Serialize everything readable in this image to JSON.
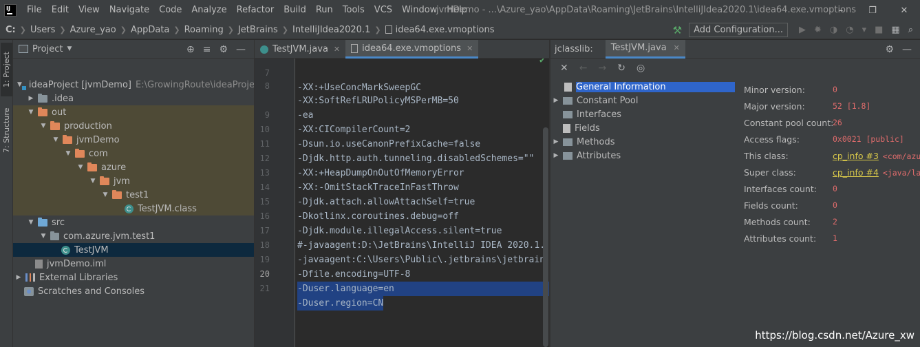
{
  "titlebar": {
    "menu": [
      "File",
      "Edit",
      "View",
      "Navigate",
      "Code",
      "Analyze",
      "Refactor",
      "Build",
      "Run",
      "Tools",
      "VCS",
      "Window",
      "Help"
    ],
    "window_title": "jvmDemo - ...\\Azure_yao\\AppData\\Roaming\\JetBrains\\IntelliJIdea2020.1\\idea64.exe.vmoptions"
  },
  "navbar": {
    "breadcrumbs": [
      "C:",
      "Users",
      "Azure_yao",
      "AppData",
      "Roaming",
      "JetBrains",
      "IntelliJIdea2020.1",
      "idea64.exe.vmoptions"
    ],
    "config_button": "Add Configuration..."
  },
  "left_strip": {
    "tabs": [
      "1: Project",
      "7: Structure"
    ]
  },
  "project_panel": {
    "title": "Project",
    "tree": [
      {
        "label": "ideaProject",
        "bold": "[jvmDemo]",
        "hint": "E:\\GrowingRoute\\ideaProject"
      },
      {
        "label": ".idea"
      },
      {
        "label": "out"
      },
      {
        "label": "production"
      },
      {
        "label": "jvmDemo"
      },
      {
        "label": "com"
      },
      {
        "label": "azure"
      },
      {
        "label": "jvm"
      },
      {
        "label": "test1"
      },
      {
        "label": "TestJVM.class"
      },
      {
        "label": "src"
      },
      {
        "label": "com.azure.jvm.test1"
      },
      {
        "label": "TestJVM"
      },
      {
        "label": "jvmDemo.iml"
      },
      {
        "label": "External Libraries"
      },
      {
        "label": "Scratches and Consoles"
      }
    ]
  },
  "editor": {
    "tabs": [
      {
        "label": "TestJVM.java"
      },
      {
        "label": "idea64.exe.vmoptions"
      }
    ],
    "lines": [
      {
        "n": "7",
        "text": "-XX:+UseConcMarkSweepGC"
      },
      {
        "n": "8",
        "text": "-XX:SoftRefLRUPolicyMSPerMB=50"
      },
      {
        "n": "",
        "text": "-ea"
      },
      {
        "n": "9",
        "text": "-XX:CICompilerCount=2"
      },
      {
        "n": "10",
        "text": "-Dsun.io.useCanonPrefixCache=false"
      },
      {
        "n": "11",
        "text": "-Djdk.http.auth.tunneling.disabledSchemes=\"\""
      },
      {
        "n": "12",
        "text": "-XX:+HeapDumpOnOutOfMemoryError"
      },
      {
        "n": "13",
        "text": "-XX:-OmitStackTraceInFastThrow"
      },
      {
        "n": "14",
        "text": "-Djdk.attach.allowAttachSelf=true"
      },
      {
        "n": "15",
        "text": "-Dkotlinx.coroutines.debug=off"
      },
      {
        "n": "16",
        "text": "-Djdk.module.illegalAccess.silent=true"
      },
      {
        "n": "17",
        "text": "#-javaagent:D:\\JetBrains\\IntelliJ IDEA 2020.1."
      },
      {
        "n": "18",
        "text": "-javaagent:C:\\Users\\Public\\.jetbrains\\jetbrain"
      },
      {
        "n": "19",
        "text": "-Dfile.encoding=UTF-8"
      },
      {
        "n": "20",
        "text": "-Duser.language=en"
      },
      {
        "n": "21",
        "text": "-Duser.region=CN"
      }
    ]
  },
  "jclasslib": {
    "label": "jclasslib:",
    "tab": "TestJVM.java",
    "tree": [
      "General Information",
      "Constant Pool",
      "Interfaces",
      "Fields",
      "Methods",
      "Attributes"
    ],
    "info": [
      {
        "label": "Minor version:",
        "value": "0"
      },
      {
        "label": "Major version:",
        "value": "52 [1.8]"
      },
      {
        "label": "Constant pool count:",
        "value": "26"
      },
      {
        "label": "Access flags:",
        "value": "0x0021 [public]"
      },
      {
        "label": "This class:",
        "link": "cp_info #3",
        "ref": "<com/azu"
      },
      {
        "label": "Super class:",
        "link": "cp_info #4",
        "ref": "<java/la"
      },
      {
        "label": "Interfaces count:",
        "value": "0"
      },
      {
        "label": "Fields count:",
        "value": "0"
      },
      {
        "label": "Methods count:",
        "value": "2"
      },
      {
        "label": "Attributes count:",
        "value": "1"
      }
    ]
  },
  "watermark": "https://blog.csdn.net/Azure_xw"
}
